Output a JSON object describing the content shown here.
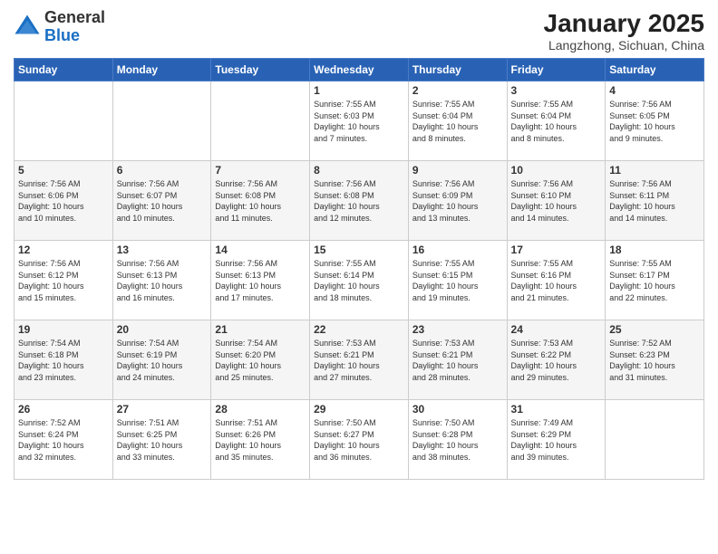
{
  "header": {
    "logo_general": "General",
    "logo_blue": "Blue",
    "title": "January 2025",
    "subtitle": "Langzhong, Sichuan, China"
  },
  "weekdays": [
    "Sunday",
    "Monday",
    "Tuesday",
    "Wednesday",
    "Thursday",
    "Friday",
    "Saturday"
  ],
  "weeks": [
    [
      {
        "day": "",
        "info": ""
      },
      {
        "day": "",
        "info": ""
      },
      {
        "day": "",
        "info": ""
      },
      {
        "day": "1",
        "info": "Sunrise: 7:55 AM\nSunset: 6:03 PM\nDaylight: 10 hours\nand 7 minutes."
      },
      {
        "day": "2",
        "info": "Sunrise: 7:55 AM\nSunset: 6:04 PM\nDaylight: 10 hours\nand 8 minutes."
      },
      {
        "day": "3",
        "info": "Sunrise: 7:55 AM\nSunset: 6:04 PM\nDaylight: 10 hours\nand 8 minutes."
      },
      {
        "day": "4",
        "info": "Sunrise: 7:56 AM\nSunset: 6:05 PM\nDaylight: 10 hours\nand 9 minutes."
      }
    ],
    [
      {
        "day": "5",
        "info": "Sunrise: 7:56 AM\nSunset: 6:06 PM\nDaylight: 10 hours\nand 10 minutes."
      },
      {
        "day": "6",
        "info": "Sunrise: 7:56 AM\nSunset: 6:07 PM\nDaylight: 10 hours\nand 10 minutes."
      },
      {
        "day": "7",
        "info": "Sunrise: 7:56 AM\nSunset: 6:08 PM\nDaylight: 10 hours\nand 11 minutes."
      },
      {
        "day": "8",
        "info": "Sunrise: 7:56 AM\nSunset: 6:08 PM\nDaylight: 10 hours\nand 12 minutes."
      },
      {
        "day": "9",
        "info": "Sunrise: 7:56 AM\nSunset: 6:09 PM\nDaylight: 10 hours\nand 13 minutes."
      },
      {
        "day": "10",
        "info": "Sunrise: 7:56 AM\nSunset: 6:10 PM\nDaylight: 10 hours\nand 14 minutes."
      },
      {
        "day": "11",
        "info": "Sunrise: 7:56 AM\nSunset: 6:11 PM\nDaylight: 10 hours\nand 14 minutes."
      }
    ],
    [
      {
        "day": "12",
        "info": "Sunrise: 7:56 AM\nSunset: 6:12 PM\nDaylight: 10 hours\nand 15 minutes."
      },
      {
        "day": "13",
        "info": "Sunrise: 7:56 AM\nSunset: 6:13 PM\nDaylight: 10 hours\nand 16 minutes."
      },
      {
        "day": "14",
        "info": "Sunrise: 7:56 AM\nSunset: 6:13 PM\nDaylight: 10 hours\nand 17 minutes."
      },
      {
        "day": "15",
        "info": "Sunrise: 7:55 AM\nSunset: 6:14 PM\nDaylight: 10 hours\nand 18 minutes."
      },
      {
        "day": "16",
        "info": "Sunrise: 7:55 AM\nSunset: 6:15 PM\nDaylight: 10 hours\nand 19 minutes."
      },
      {
        "day": "17",
        "info": "Sunrise: 7:55 AM\nSunset: 6:16 PM\nDaylight: 10 hours\nand 21 minutes."
      },
      {
        "day": "18",
        "info": "Sunrise: 7:55 AM\nSunset: 6:17 PM\nDaylight: 10 hours\nand 22 minutes."
      }
    ],
    [
      {
        "day": "19",
        "info": "Sunrise: 7:54 AM\nSunset: 6:18 PM\nDaylight: 10 hours\nand 23 minutes."
      },
      {
        "day": "20",
        "info": "Sunrise: 7:54 AM\nSunset: 6:19 PM\nDaylight: 10 hours\nand 24 minutes."
      },
      {
        "day": "21",
        "info": "Sunrise: 7:54 AM\nSunset: 6:20 PM\nDaylight: 10 hours\nand 25 minutes."
      },
      {
        "day": "22",
        "info": "Sunrise: 7:53 AM\nSunset: 6:21 PM\nDaylight: 10 hours\nand 27 minutes."
      },
      {
        "day": "23",
        "info": "Sunrise: 7:53 AM\nSunset: 6:21 PM\nDaylight: 10 hours\nand 28 minutes."
      },
      {
        "day": "24",
        "info": "Sunrise: 7:53 AM\nSunset: 6:22 PM\nDaylight: 10 hours\nand 29 minutes."
      },
      {
        "day": "25",
        "info": "Sunrise: 7:52 AM\nSunset: 6:23 PM\nDaylight: 10 hours\nand 31 minutes."
      }
    ],
    [
      {
        "day": "26",
        "info": "Sunrise: 7:52 AM\nSunset: 6:24 PM\nDaylight: 10 hours\nand 32 minutes."
      },
      {
        "day": "27",
        "info": "Sunrise: 7:51 AM\nSunset: 6:25 PM\nDaylight: 10 hours\nand 33 minutes."
      },
      {
        "day": "28",
        "info": "Sunrise: 7:51 AM\nSunset: 6:26 PM\nDaylight: 10 hours\nand 35 minutes."
      },
      {
        "day": "29",
        "info": "Sunrise: 7:50 AM\nSunset: 6:27 PM\nDaylight: 10 hours\nand 36 minutes."
      },
      {
        "day": "30",
        "info": "Sunrise: 7:50 AM\nSunset: 6:28 PM\nDaylight: 10 hours\nand 38 minutes."
      },
      {
        "day": "31",
        "info": "Sunrise: 7:49 AM\nSunset: 6:29 PM\nDaylight: 10 hours\nand 39 minutes."
      },
      {
        "day": "",
        "info": ""
      }
    ]
  ]
}
